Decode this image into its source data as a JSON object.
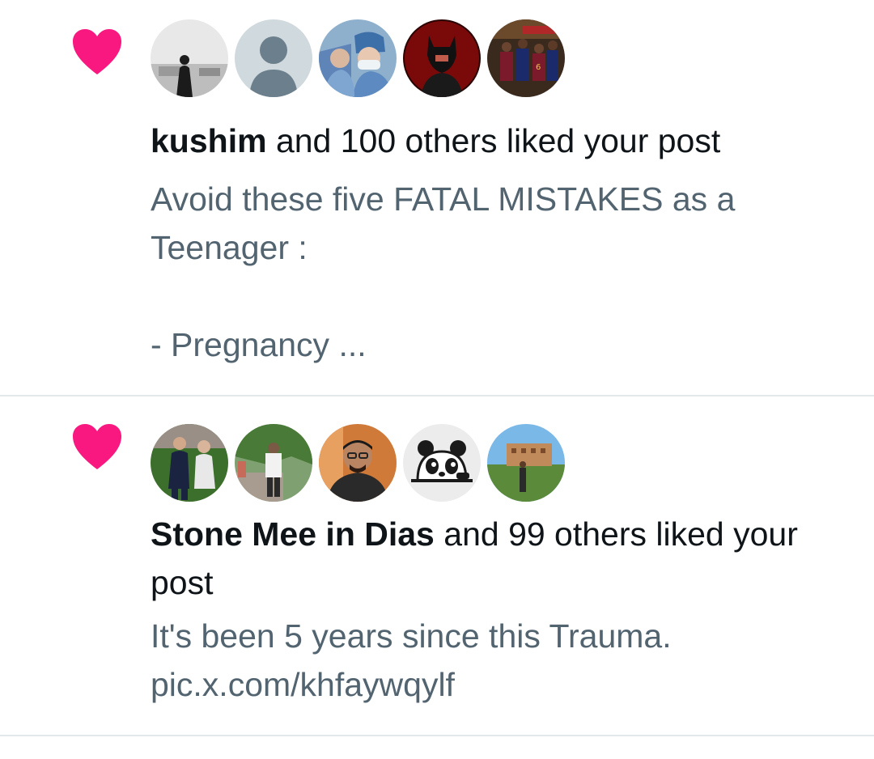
{
  "colors": {
    "heart": "#f91880",
    "primary_text": "#0f1419",
    "secondary_text": "#536471",
    "divider": "#e3e8eb"
  },
  "notifications": [
    {
      "icon": "heart-icon",
      "actor": "kushim",
      "action": " and 100 others liked your post",
      "post_text": "Avoid these five FATAL MISTAKES as a Teenager :\n\n- Pregnancy ...",
      "avatars": [
        "avatar-photo-person-outdoor",
        "avatar-default-placeholder",
        "avatar-photo-surgeons",
        "avatar-photo-batman",
        "avatar-photo-football-team"
      ]
    },
    {
      "icon": "heart-icon",
      "actor": "Stone Mee in Dias",
      "action": " and 99 others liked your post",
      "post_text": "It's been 5 years since this Trauma.\npic.x.com/khfaywqylf",
      "avatars": [
        "avatar-photo-footballers",
        "avatar-photo-person-street",
        "avatar-photo-man-glasses",
        "avatar-panda-logo",
        "avatar-photo-campus"
      ]
    }
  ]
}
